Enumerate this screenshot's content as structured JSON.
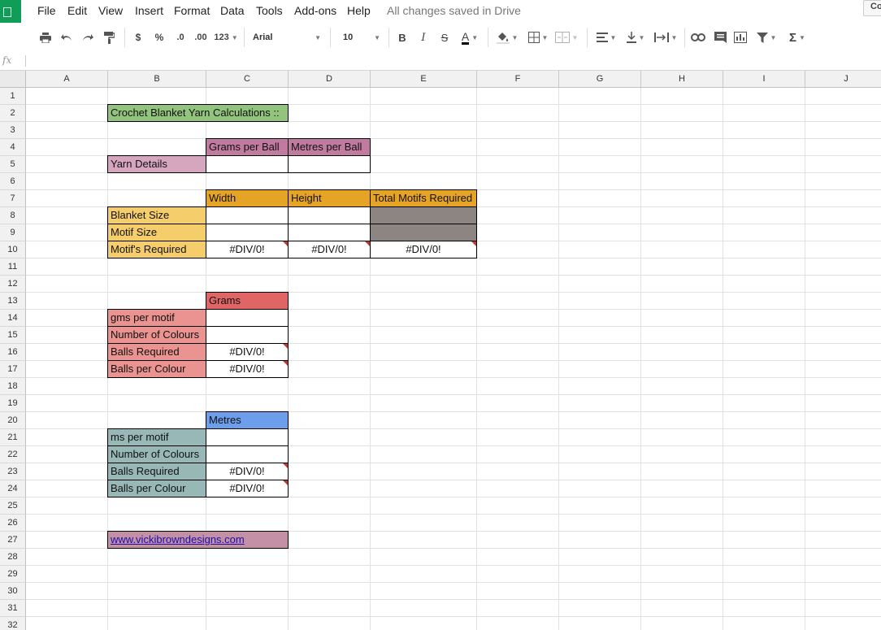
{
  "menubar": {
    "items": [
      "File",
      "Edit",
      "View",
      "Insert",
      "Format",
      "Data",
      "Tools",
      "Add-ons",
      "Help"
    ],
    "save_status": "All changes saved in Drive",
    "comments_label": "Co"
  },
  "toolbar": {
    "currency": "$",
    "percent": "%",
    "decrease_decimal": ".0",
    "increase_decimal": ".00",
    "more_formats": "123",
    "font": "Arial",
    "font_size": "10",
    "bold": "B",
    "italic": "I",
    "strikethrough": "S",
    "text_color": "A",
    "sum": "Σ",
    "text_color_value": "#000000"
  },
  "formula_bar": {
    "fx_label": "fx",
    "value": ""
  },
  "grid": {
    "columns": [
      "A",
      "B",
      "C",
      "D",
      "E",
      "F",
      "G",
      "H",
      "I",
      "J"
    ],
    "rows": [
      "1",
      "2",
      "3",
      "4",
      "5",
      "6",
      "7",
      "8",
      "9",
      "10",
      "11",
      "12",
      "13",
      "14",
      "15",
      "16",
      "17",
      "18",
      "19",
      "20",
      "21",
      "22",
      "23",
      "24",
      "25",
      "26",
      "27",
      "28",
      "29",
      "30",
      "31",
      "32"
    ]
  },
  "cells": {
    "B2": "Crochet Blanket Yarn Calculations ::",
    "C4": "Grams per Ball",
    "D4": "Metres per Ball",
    "B5": "Yarn Details",
    "C7": "Width",
    "D7": "Height",
    "E7": "Total Motifs Required",
    "B8": "Blanket Size",
    "B9": "Motif Size",
    "B10": "Motif's Required",
    "C10": "#DIV/0!",
    "D10": "#DIV/0!",
    "E10": "#DIV/0!",
    "C13": "Grams",
    "B14": "gms per motif",
    "B15": "Number of Colours",
    "B16": "Balls Required",
    "C16": "#DIV/0!",
    "B17": "Balls per Colour",
    "C17": "#DIV/0!",
    "C20": "Metres",
    "B21": "ms per motif",
    "B22": "Number of Colours",
    "B23": "Balls Required",
    "C23": "#DIV/0!",
    "B24": "Balls per Colour",
    "C24": "#DIV/0!",
    "B27": "www.vickibrowndesigns.com"
  },
  "colors": {
    "brand_green": "#0f9d58",
    "title_green": "#93c47d",
    "header_purple": "#c27ba0",
    "pink_label": "#d5a6bd",
    "orange_header": "#e6a427",
    "yellow_label": "#f6cd6b",
    "gray_fill": "#8c8582",
    "red_header": "#e06666",
    "salmon_label": "#ea9390",
    "blue_header": "#6d9eeb",
    "teal_label": "#97b8b6",
    "link_mauve": "#c490a6",
    "error_flag": "#c0392b"
  }
}
